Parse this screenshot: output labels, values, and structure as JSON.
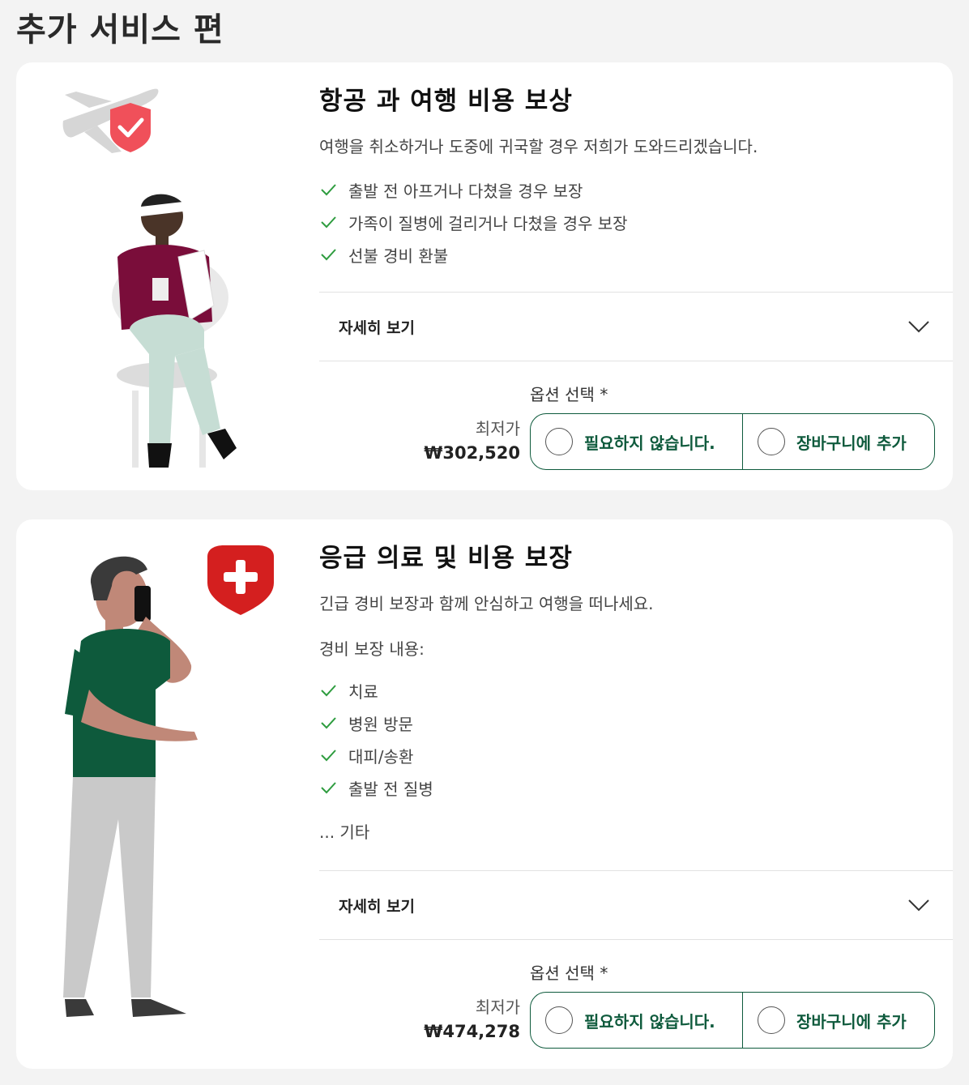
{
  "page": {
    "title": "추가 서비스 편"
  },
  "colors": {
    "accent": "#0e5a3c",
    "check": "#2e9c3f",
    "shield_travel": "#f0505a",
    "shield_medical": "#d41f1f"
  },
  "cards": [
    {
      "title": "항공 과 여행 비용 보상",
      "description": "여행을 취소하거나 도중에 귀국할 경우 저희가 도와드리겠습니다.",
      "benefits": [
        "출발 전 아프거나 다쳤을 경우 보장",
        "가족이 질병에 걸리거나 다쳤을 경우 보장",
        "선불 경비 환불"
      ],
      "details_label": "자세히 보기",
      "option_label": "옵션 선택 *",
      "price_label": "최저가",
      "price": "₩302,520",
      "choices": [
        "필요하지 않습니다.",
        "장바구니에 추가"
      ],
      "icons": [
        "plane-icon",
        "shield-check-icon"
      ]
    },
    {
      "title": "응급 의료 및 비용 보장",
      "description": "긴급 경비 보장과 함께 안심하고 여행을 떠나세요.",
      "subheading": "경비 보장 내용:",
      "benefits": [
        "치료",
        "병원 방문",
        "대피/송환",
        "출발 전 질병"
      ],
      "more": "... 기타",
      "details_label": "자세히 보기",
      "option_label": "옵션 선택 *",
      "price_label": "최저가",
      "price": "₩474,278",
      "choices": [
        "필요하지 않습니다.",
        "장바구니에 추가"
      ],
      "icons": [
        "shield-plus-icon"
      ]
    }
  ]
}
